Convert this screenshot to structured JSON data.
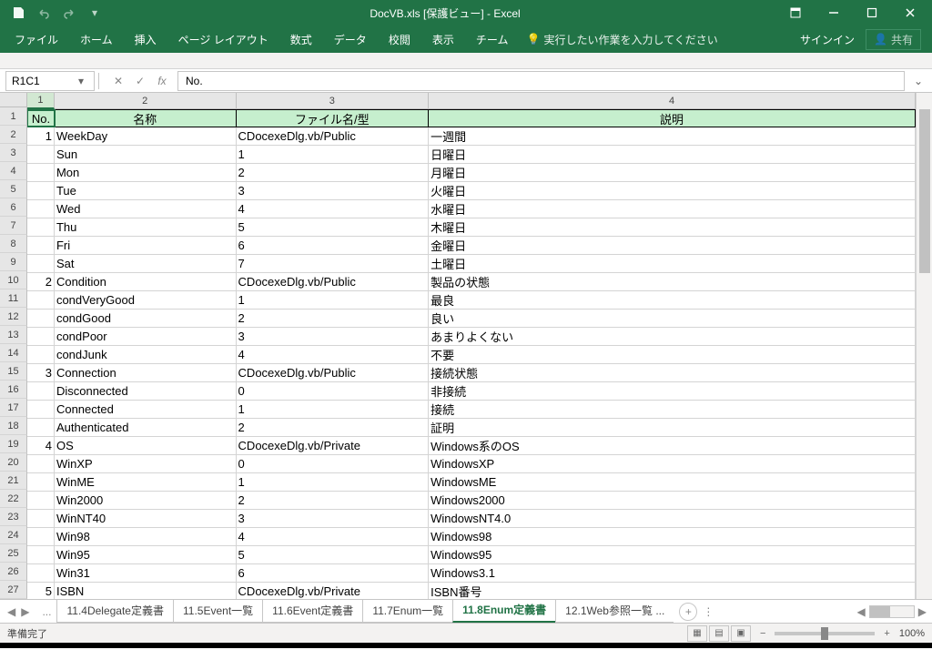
{
  "title": "DocVB.xls [保護ビュー] - Excel",
  "ribbon": {
    "tabs": [
      "ファイル",
      "ホーム",
      "挿入",
      "ページ レイアウト",
      "数式",
      "データ",
      "校閲",
      "表示",
      "チーム"
    ],
    "tellme": "実行したい作業を入力してください",
    "signin": "サインイン",
    "share": "共有"
  },
  "formula_bar": {
    "name_box": "R1C1",
    "formula": "No."
  },
  "columns": [
    "1",
    "2",
    "3",
    "4"
  ],
  "header_cells": [
    "No.",
    "名称",
    "ファイル名/型",
    "説明"
  ],
  "rows": [
    {
      "no": "1",
      "name": "WeekDay",
      "file": "CDocexeDlg.vb/Public",
      "desc": "一週間"
    },
    {
      "no": "",
      "name": "Sun",
      "file": "1",
      "desc": "日曜日"
    },
    {
      "no": "",
      "name": "Mon",
      "file": "2",
      "desc": "月曜日"
    },
    {
      "no": "",
      "name": "Tue",
      "file": "3",
      "desc": "火曜日"
    },
    {
      "no": "",
      "name": "Wed",
      "file": "4",
      "desc": "水曜日"
    },
    {
      "no": "",
      "name": "Thu",
      "file": "5",
      "desc": "木曜日"
    },
    {
      "no": "",
      "name": "Fri",
      "file": "6",
      "desc": "金曜日"
    },
    {
      "no": "",
      "name": "Sat",
      "file": "7",
      "desc": "土曜日"
    },
    {
      "no": "2",
      "name": "Condition",
      "file": "CDocexeDlg.vb/Public",
      "desc": "製品の状態"
    },
    {
      "no": "",
      "name": "condVeryGood",
      "file": "1",
      "desc": "最良"
    },
    {
      "no": "",
      "name": "condGood",
      "file": "2",
      "desc": "良い"
    },
    {
      "no": "",
      "name": "condPoor",
      "file": "3",
      "desc": "あまりよくない"
    },
    {
      "no": "",
      "name": "condJunk",
      "file": "4",
      "desc": "不要"
    },
    {
      "no": "3",
      "name": "Connection",
      "file": "CDocexeDlg.vb/Public",
      "desc": "接続状態"
    },
    {
      "no": "",
      "name": "Disconnected",
      "file": "0",
      "desc": "非接続"
    },
    {
      "no": "",
      "name": "Connected",
      "file": "1",
      "desc": "接続"
    },
    {
      "no": "",
      "name": "Authenticated",
      "file": "2",
      "desc": "証明"
    },
    {
      "no": "4",
      "name": "OS",
      "file": "CDocexeDlg.vb/Private",
      "desc": "Windows系のOS"
    },
    {
      "no": "",
      "name": "WinXP",
      "file": "0",
      "desc": "WindowsXP"
    },
    {
      "no": "",
      "name": "WinME",
      "file": "1",
      "desc": "WindowsME"
    },
    {
      "no": "",
      "name": "Win2000",
      "file": "2",
      "desc": "Windows2000"
    },
    {
      "no": "",
      "name": "WinNT40",
      "file": "3",
      "desc": "WindowsNT4.0"
    },
    {
      "no": "",
      "name": "Win98",
      "file": "4",
      "desc": "Windows98"
    },
    {
      "no": "",
      "name": "Win95",
      "file": "5",
      "desc": "Windows95"
    },
    {
      "no": "",
      "name": "Win31",
      "file": "6",
      "desc": "Windows3.1"
    },
    {
      "no": "5",
      "name": "ISBN",
      "file": "CDocexeDlg.vb/Private",
      "desc": "ISBN番号"
    }
  ],
  "sheet_tabs": {
    "prefix": "...",
    "list": [
      "11.4Delegate定義書",
      "11.5Event一覧",
      "11.6Event定義書",
      "11.7Enum一覧",
      "11.8Enum定義書",
      "12.1Web参照一覧 ..."
    ],
    "active_index": 4
  },
  "status": {
    "left": "準備完了",
    "zoom": "100%"
  }
}
